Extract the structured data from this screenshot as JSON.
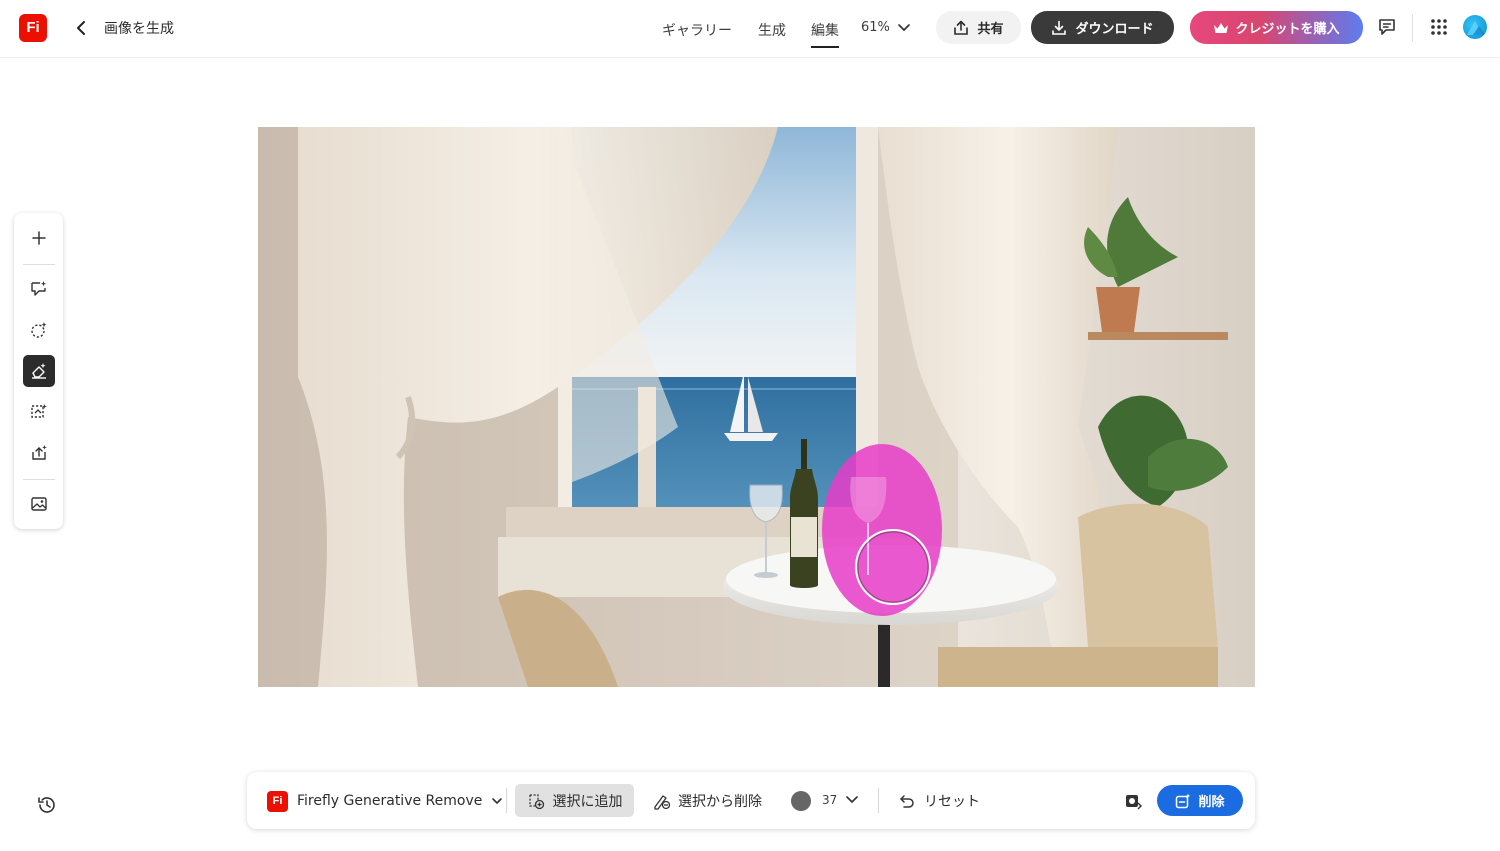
{
  "header": {
    "logo_text": "Fi",
    "back_icon": "chevron-left-icon",
    "title": "画像を生成",
    "tabs": [
      {
        "label": "ギャラリー",
        "active": false
      },
      {
        "label": "生成",
        "active": false
      },
      {
        "label": "編集",
        "active": true
      }
    ],
    "zoom": "61%",
    "share_label": "共有",
    "download_label": "ダウンロード",
    "credits_label": "クレジットを購入",
    "icons": [
      "upload-icon",
      "download-icon",
      "crown-icon",
      "comment-icon",
      "apps-grid-icon",
      "avatar"
    ]
  },
  "left_toolbar": {
    "tools": [
      {
        "name": "add-tool",
        "icon": "plus-icon",
        "active": false
      },
      {
        "name": "generative-fill-tool",
        "icon": "chat-sparkle-icon",
        "active": false
      },
      {
        "name": "select-object-tool",
        "icon": "dashed-select-icon",
        "active": false
      },
      {
        "name": "remove-tool",
        "icon": "eraser-icon",
        "active": true
      },
      {
        "name": "expand-tool",
        "icon": "expand-sparkle-icon",
        "active": false
      },
      {
        "name": "upload-image-tool",
        "icon": "upload-sparkle-icon",
        "active": false
      },
      {
        "name": "image-tool",
        "icon": "image-icon",
        "active": false
      }
    ]
  },
  "history_icon": "history-icon",
  "bottom_bar": {
    "model_logo": "Fi",
    "model_label": "Firefly Generative Remove",
    "add_selection_label": "選択に追加",
    "subtract_selection_label": "選択から削除",
    "brush_size": "37",
    "reset_label": "リセット",
    "delete_label": "削除"
  },
  "colors": {
    "brand_red": "#eb1000",
    "primary_blue": "#1b6ce0",
    "download_dark": "#3a3a3a",
    "credits_pink": "#e7477e",
    "selection_mask": "#e83cc8"
  }
}
